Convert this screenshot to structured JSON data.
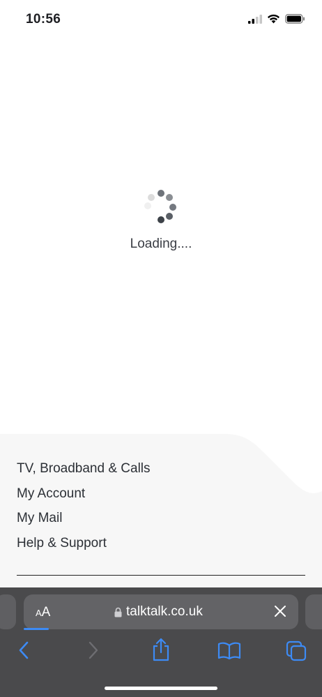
{
  "status_bar": {
    "time": "10:56",
    "icons": [
      "signal-icon",
      "wifi-icon",
      "battery-icon"
    ]
  },
  "loading": {
    "text": "Loading...."
  },
  "footer": {
    "links": [
      "TV, Broadband & Calls",
      "My Account",
      "My Mail",
      "Help & Support"
    ]
  },
  "browser": {
    "text_size_label_small": "A",
    "text_size_label_large": "A",
    "url": "talktalk.co.uk",
    "accent_color": "#3d8bf5",
    "toolbar_icons": [
      "back-icon",
      "forward-icon",
      "share-icon",
      "bookmarks-icon",
      "tabs-icon"
    ]
  }
}
